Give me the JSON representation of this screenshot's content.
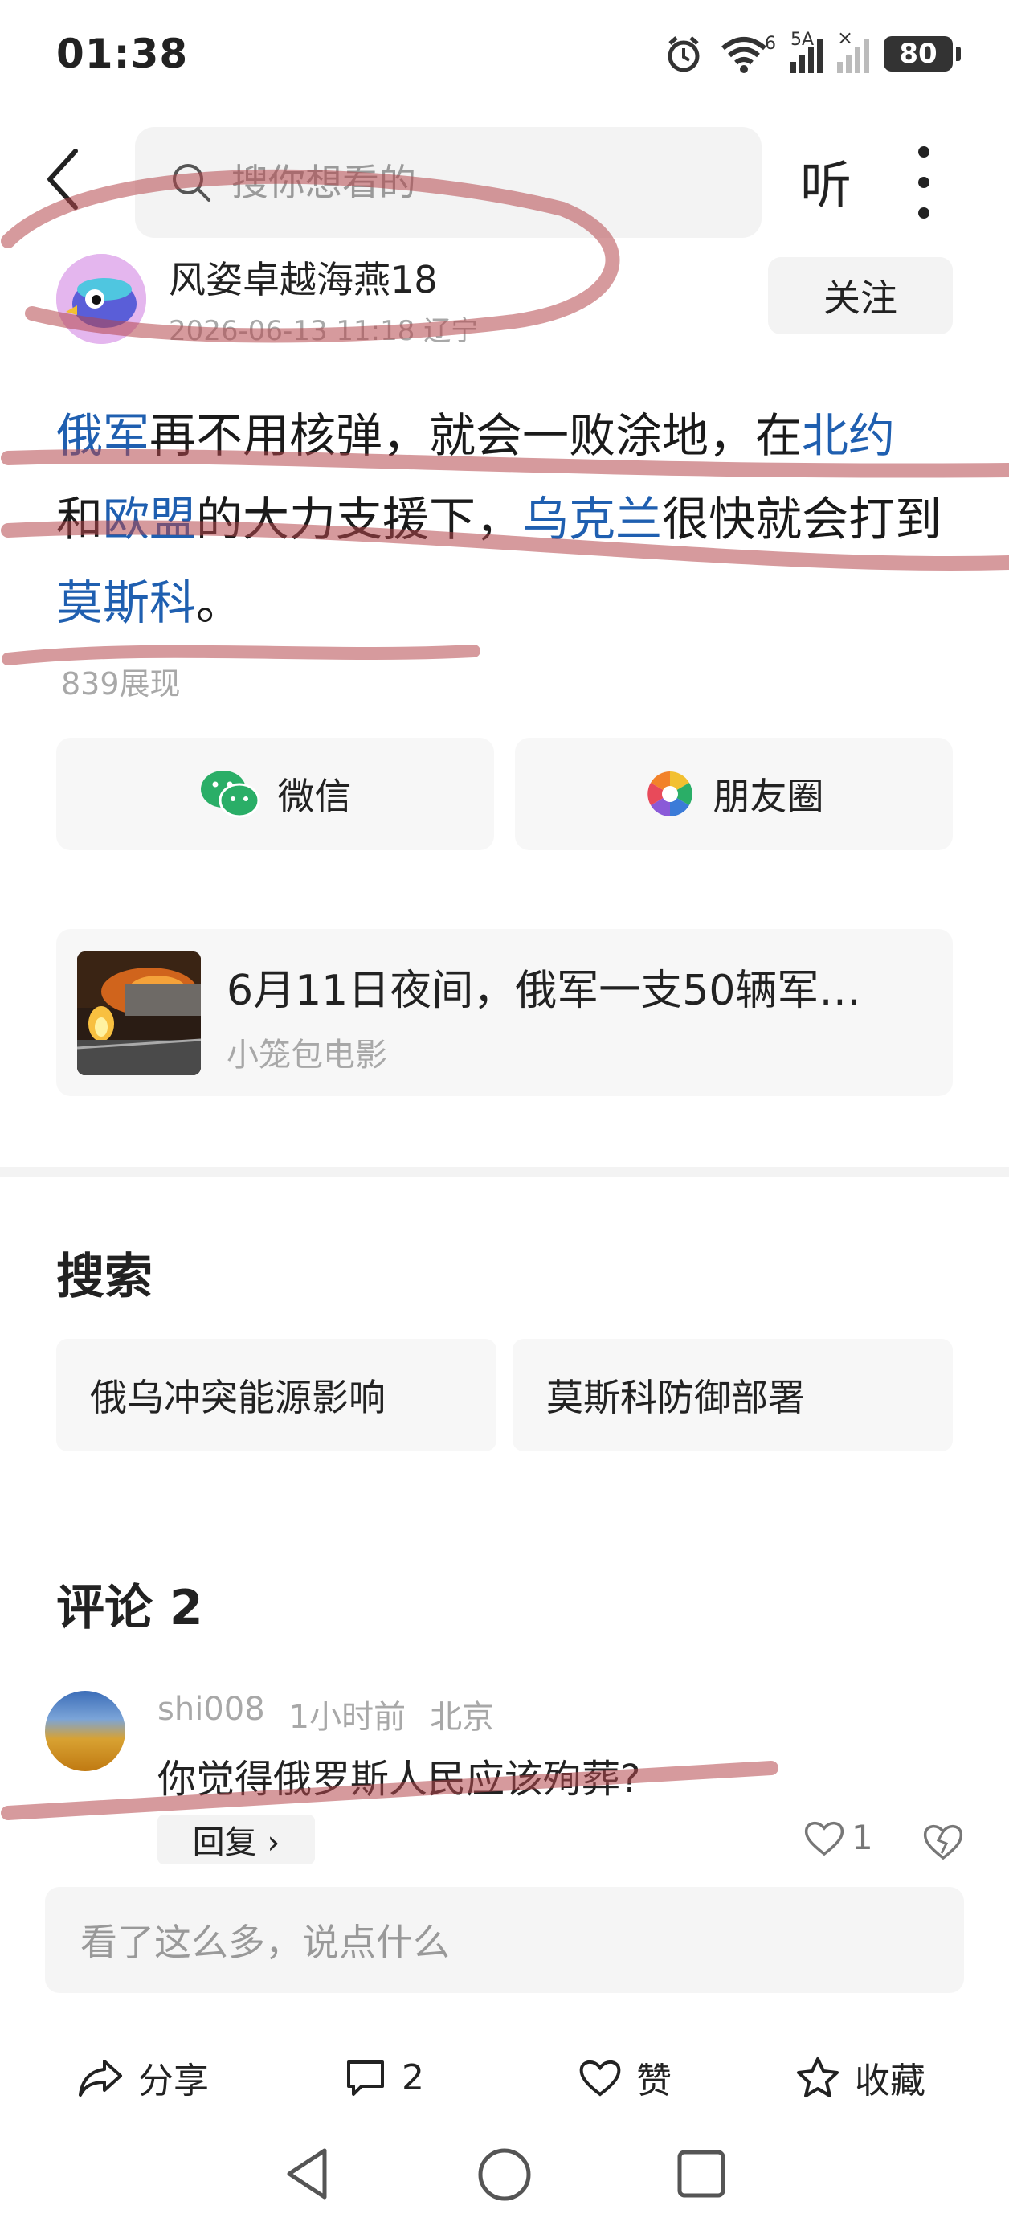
{
  "status_bar": {
    "time": "01:38",
    "network_label": "5A",
    "wifi_label": "6",
    "battery": "80"
  },
  "top_nav": {
    "search_placeholder": "搜你想看的",
    "listen_label": "听"
  },
  "author": {
    "name": "风姿卓越海燕18",
    "meta": "2026-06-13 11:18 辽宁",
    "follow_label": "关注"
  },
  "article": {
    "segments": [
      {
        "text": "俄军",
        "link": true
      },
      {
        "text": "再不用核弹，就会一败涂地，在",
        "link": false
      },
      {
        "text": "北约",
        "link": true
      },
      {
        "text": "和",
        "link": false
      },
      {
        "text": "欧盟",
        "link": true
      },
      {
        "text": "的大力支援下，",
        "link": false
      },
      {
        "text": "乌克兰",
        "link": true
      },
      {
        "text": "很快就会打到",
        "link": false
      },
      {
        "text": "莫斯科",
        "link": true
      },
      {
        "text": "。",
        "link": false
      }
    ],
    "views": "839展现"
  },
  "share": {
    "wechat_label": "微信",
    "moments_label": "朋友圈"
  },
  "related": {
    "title": "6月11日夜间，俄军一支50辆军…",
    "source": "小笼包电影"
  },
  "search_section": {
    "title": "搜索",
    "chips": [
      "俄乌冲突能源影响",
      "莫斯科防御部署"
    ]
  },
  "comments_section": {
    "title": "评论 2",
    "comment": {
      "user": "shi008",
      "time": "1小时前",
      "location": "北京",
      "text": "你觉得俄罗斯人民应该殉葬?",
      "reply_label": "回复 ›",
      "likes": "1"
    },
    "input_placeholder": "看了这么多，说点什么"
  },
  "bottom_bar": {
    "share_label": "分享",
    "comment_count": "2",
    "like_label": "赞",
    "collect_label": "收藏"
  },
  "colors": {
    "link": "#1f5fb0",
    "wechat_green": "#2aae67",
    "annotation_red": "#b5474d"
  }
}
